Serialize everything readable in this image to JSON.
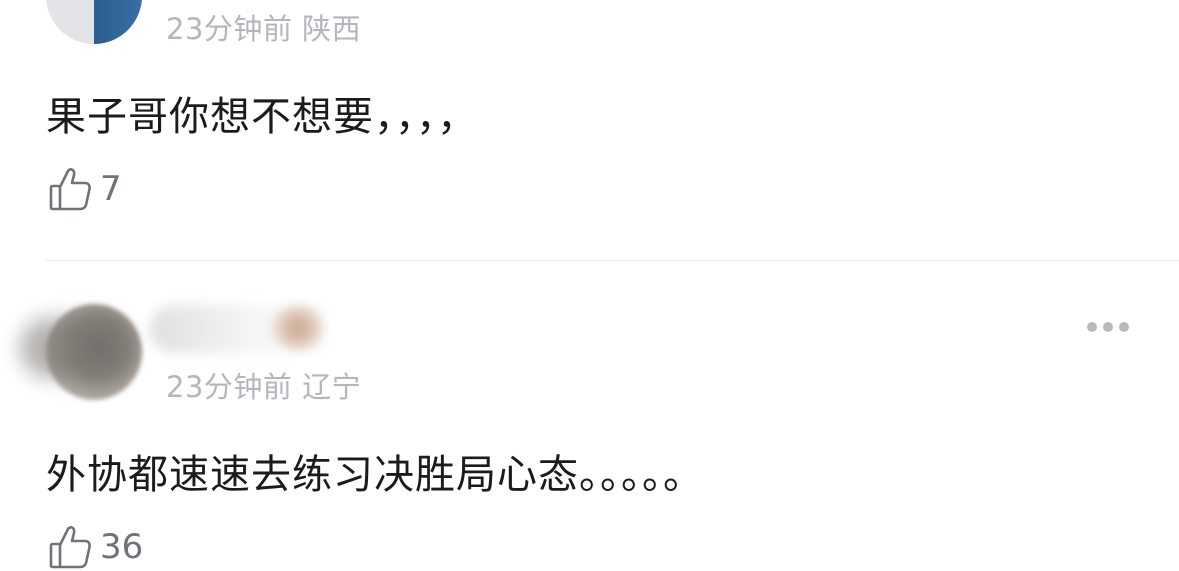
{
  "comments": [
    {
      "meta": "23分钟前 陕西",
      "text": "果子哥你想不想要，，，，",
      "likes": "7",
      "avatar_icon": "user-avatar"
    },
    {
      "meta": "23分钟前 辽宁",
      "text": "外协都速速去练习决胜局心态。。。。。",
      "likes": "36",
      "avatar_icon": "user-avatar",
      "username_blurred": true
    }
  ],
  "icons": {
    "like": "thumbs-up-icon",
    "more": "more-dots-icon"
  },
  "colors": {
    "meta_text": "#b4b6bb",
    "comment_text": "#1b1b1b",
    "like_text": "#6f7278",
    "divider": "#e6e7ea",
    "icon_gray": "#6f7278"
  }
}
